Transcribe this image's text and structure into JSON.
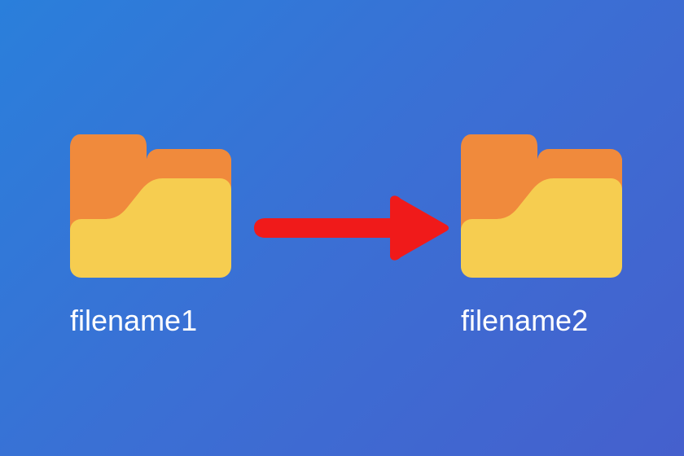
{
  "folders": {
    "left": {
      "label": "filename1"
    },
    "right": {
      "label": "filename2"
    }
  },
  "colors": {
    "folder_back": "#f08a3c",
    "folder_front": "#f6cd50",
    "arrow": "#f01a1a"
  }
}
